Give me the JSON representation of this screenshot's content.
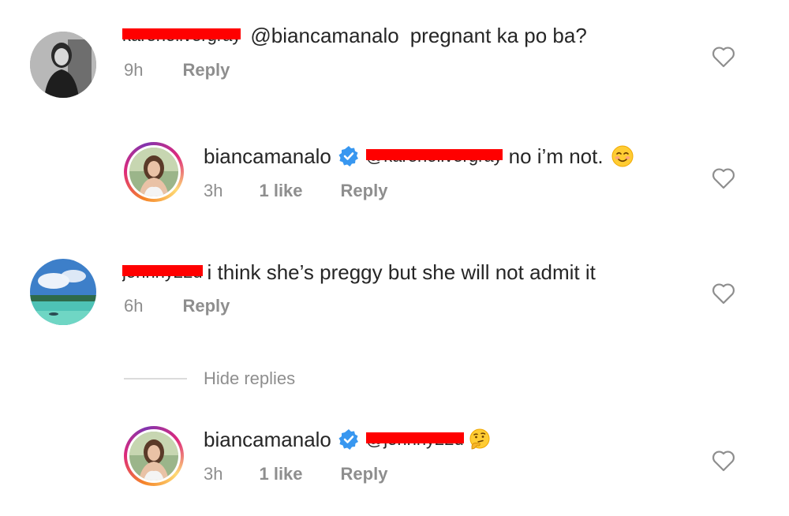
{
  "comments": [
    {
      "username_redacted": "karenoilvergray",
      "mention": "@biancamanalo",
      "text": "pregnant ka po ba?",
      "time": "9h",
      "reply_label": "Reply"
    },
    {
      "username": "biancamanalo",
      "mention_redacted": "@karenoilvergray",
      "text": "no i’m not.",
      "emoji": "smiling-face-icon",
      "time": "3h",
      "likes": "1 like",
      "reply_label": "Reply"
    },
    {
      "username_redacted": "johnny22d",
      "text": "i think she’s preggy but she will not admit it",
      "time": "6h",
      "reply_label": "Reply"
    },
    {
      "username": "biancamanalo",
      "mention_redacted": "@johnny22d",
      "emoji": "thinking-face-icon",
      "time": "3h",
      "likes": "1 like",
      "reply_label": "Reply"
    }
  ],
  "hide_replies_label": "Hide replies",
  "colors": {
    "redaction": "#ff0000",
    "verified": "#3897f0",
    "meta_text": "#8e8e8e",
    "text": "#262626"
  }
}
